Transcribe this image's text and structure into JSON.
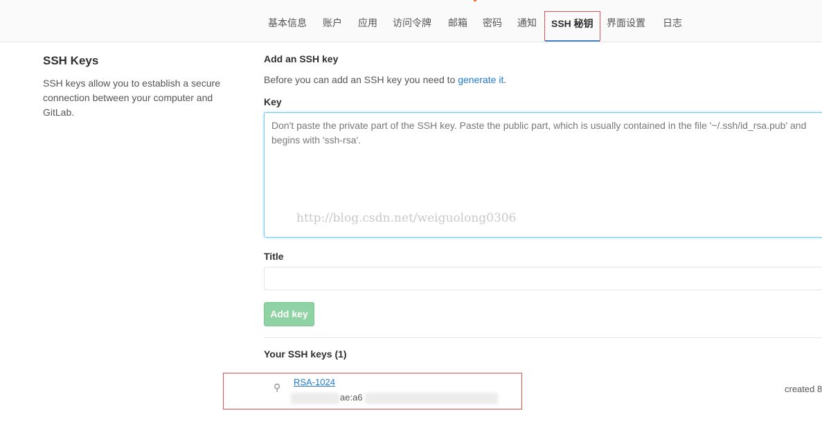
{
  "nav": {
    "tabs": [
      {
        "label": "基本信息"
      },
      {
        "label": "账户"
      },
      {
        "label": "应用"
      },
      {
        "label": "访问令牌"
      },
      {
        "label": "邮箱"
      },
      {
        "label": "密码"
      },
      {
        "label": "通知"
      },
      {
        "label": "SSH 秘钥",
        "active": true
      },
      {
        "label": "界面设置"
      },
      {
        "label": "日志"
      }
    ]
  },
  "sidebar": {
    "title": "SSH Keys",
    "description": "SSH keys allow you to establish a secure connection between your computer and GitLab."
  },
  "form": {
    "section_title": "Add an SSH key",
    "help_prefix": "Before you can add an SSH key you need to ",
    "help_link": "generate it",
    "help_suffix": ".",
    "key_label": "Key",
    "key_placeholder": "Don't paste the private part of the SSH key. Paste the public part, which is usually contained in the file '~/.ssh/id_rsa.pub' and begins with 'ssh-rsa'.",
    "watermark": "http://blog.csdn.net/weiguolong0306",
    "title_label": "Title",
    "title_value": "",
    "add_button": "Add key"
  },
  "keys": {
    "heading": "Your SSH keys (1)",
    "items": [
      {
        "name": "RSA-1024",
        "fingerprint_fragment": "ae:a6",
        "created": "created 8"
      }
    ]
  },
  "colors": {
    "link": "#1f78d1",
    "add_button_bg": "#8fd3a4",
    "annotation_red": "#d9534f",
    "active_tab_underline": "#4a80c8",
    "focus_border": "#73c9f1"
  }
}
